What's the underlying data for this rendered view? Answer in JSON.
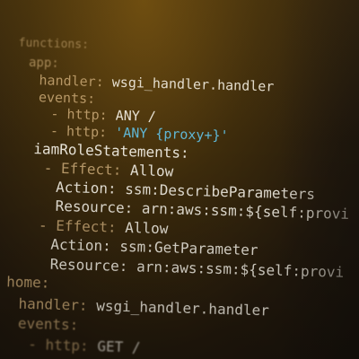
{
  "code_lines": [
    {
      "key": "functions:",
      "value": "",
      "string": ""
    },
    {
      "key": "app:",
      "value": "",
      "string": ""
    },
    {
      "key": "handler: ",
      "value": "wsgi_handler.handler",
      "string": ""
    },
    {
      "key": "events:",
      "value": "",
      "string": ""
    },
    {
      "key": "- http: ",
      "value": "ANY /",
      "string": ""
    },
    {
      "key": "- http: ",
      "value": "",
      "string": "'ANY {proxy+}'"
    },
    {
      "key": "iamRoleStatements:",
      "value": "",
      "string": ""
    },
    {
      "key": "- Effect: ",
      "value": "Allow",
      "string": ""
    },
    {
      "key": "Action: ",
      "value": "ssm:DescribeParameters",
      "string": ""
    },
    {
      "key": "Resource: ",
      "value": "arn:aws:ssm:${self:provi",
      "string": ""
    },
    {
      "key": "- Effect: ",
      "value": "Allow",
      "string": ""
    },
    {
      "key": "Action: ",
      "value": "ssm:GetParameter",
      "string": ""
    },
    {
      "key": "Resource: ",
      "value": "arn:aws:ssm:${self:provi",
      "string": ""
    },
    {
      "key": "home:",
      "value": "",
      "string": ""
    },
    {
      "key": "handler: ",
      "value": "wsgi_handler.handler",
      "string": ""
    },
    {
      "key": "events:",
      "value": "",
      "string": ""
    },
    {
      "key": "- http: ",
      "value": "GET /",
      "string": ""
    }
  ],
  "colors": {
    "key": "#b99a6a",
    "value": "#e9e4d8",
    "string": "#5fb7d6",
    "background": "#241a0d"
  }
}
